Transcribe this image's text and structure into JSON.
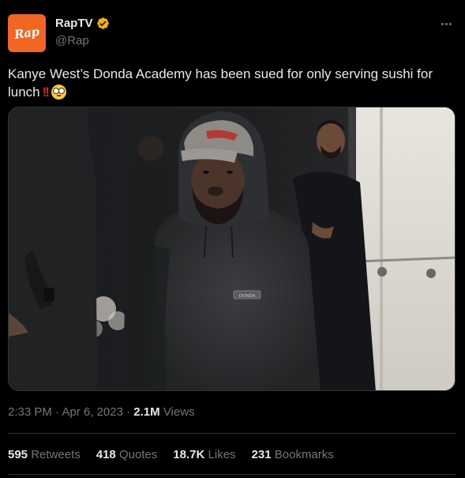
{
  "author": {
    "display_name": "RapTV",
    "handle": "@Rap",
    "avatar_text": "Rap",
    "verified_color": "#f5b400",
    "avatar_color": "#f26522"
  },
  "tweet": {
    "text": "Kanye West’s Donda Academy has been sued for only serving sushi for lunch",
    "emoji_bangs": "!!",
    "emoji_face": "flushed-face"
  },
  "meta": {
    "time": "2:33 PM",
    "separator": "·",
    "date": "Apr 6, 2023",
    "views_count": "2.1M",
    "views_label": "Views"
  },
  "stats": {
    "retweets": {
      "count": "595",
      "label": "Retweets"
    },
    "quotes": {
      "count": "418",
      "label": "Quotes"
    },
    "likes": {
      "count": "18.7K",
      "label": "Likes"
    },
    "bookmarks": {
      "count": "231",
      "label": "Bookmarks"
    }
  },
  "media": {
    "hoodie_logo_text": "DONDA"
  },
  "colors": {
    "background": "#000000",
    "text_primary": "#e7e9ea",
    "text_secondary": "#71767b",
    "border": "#2f3336"
  }
}
